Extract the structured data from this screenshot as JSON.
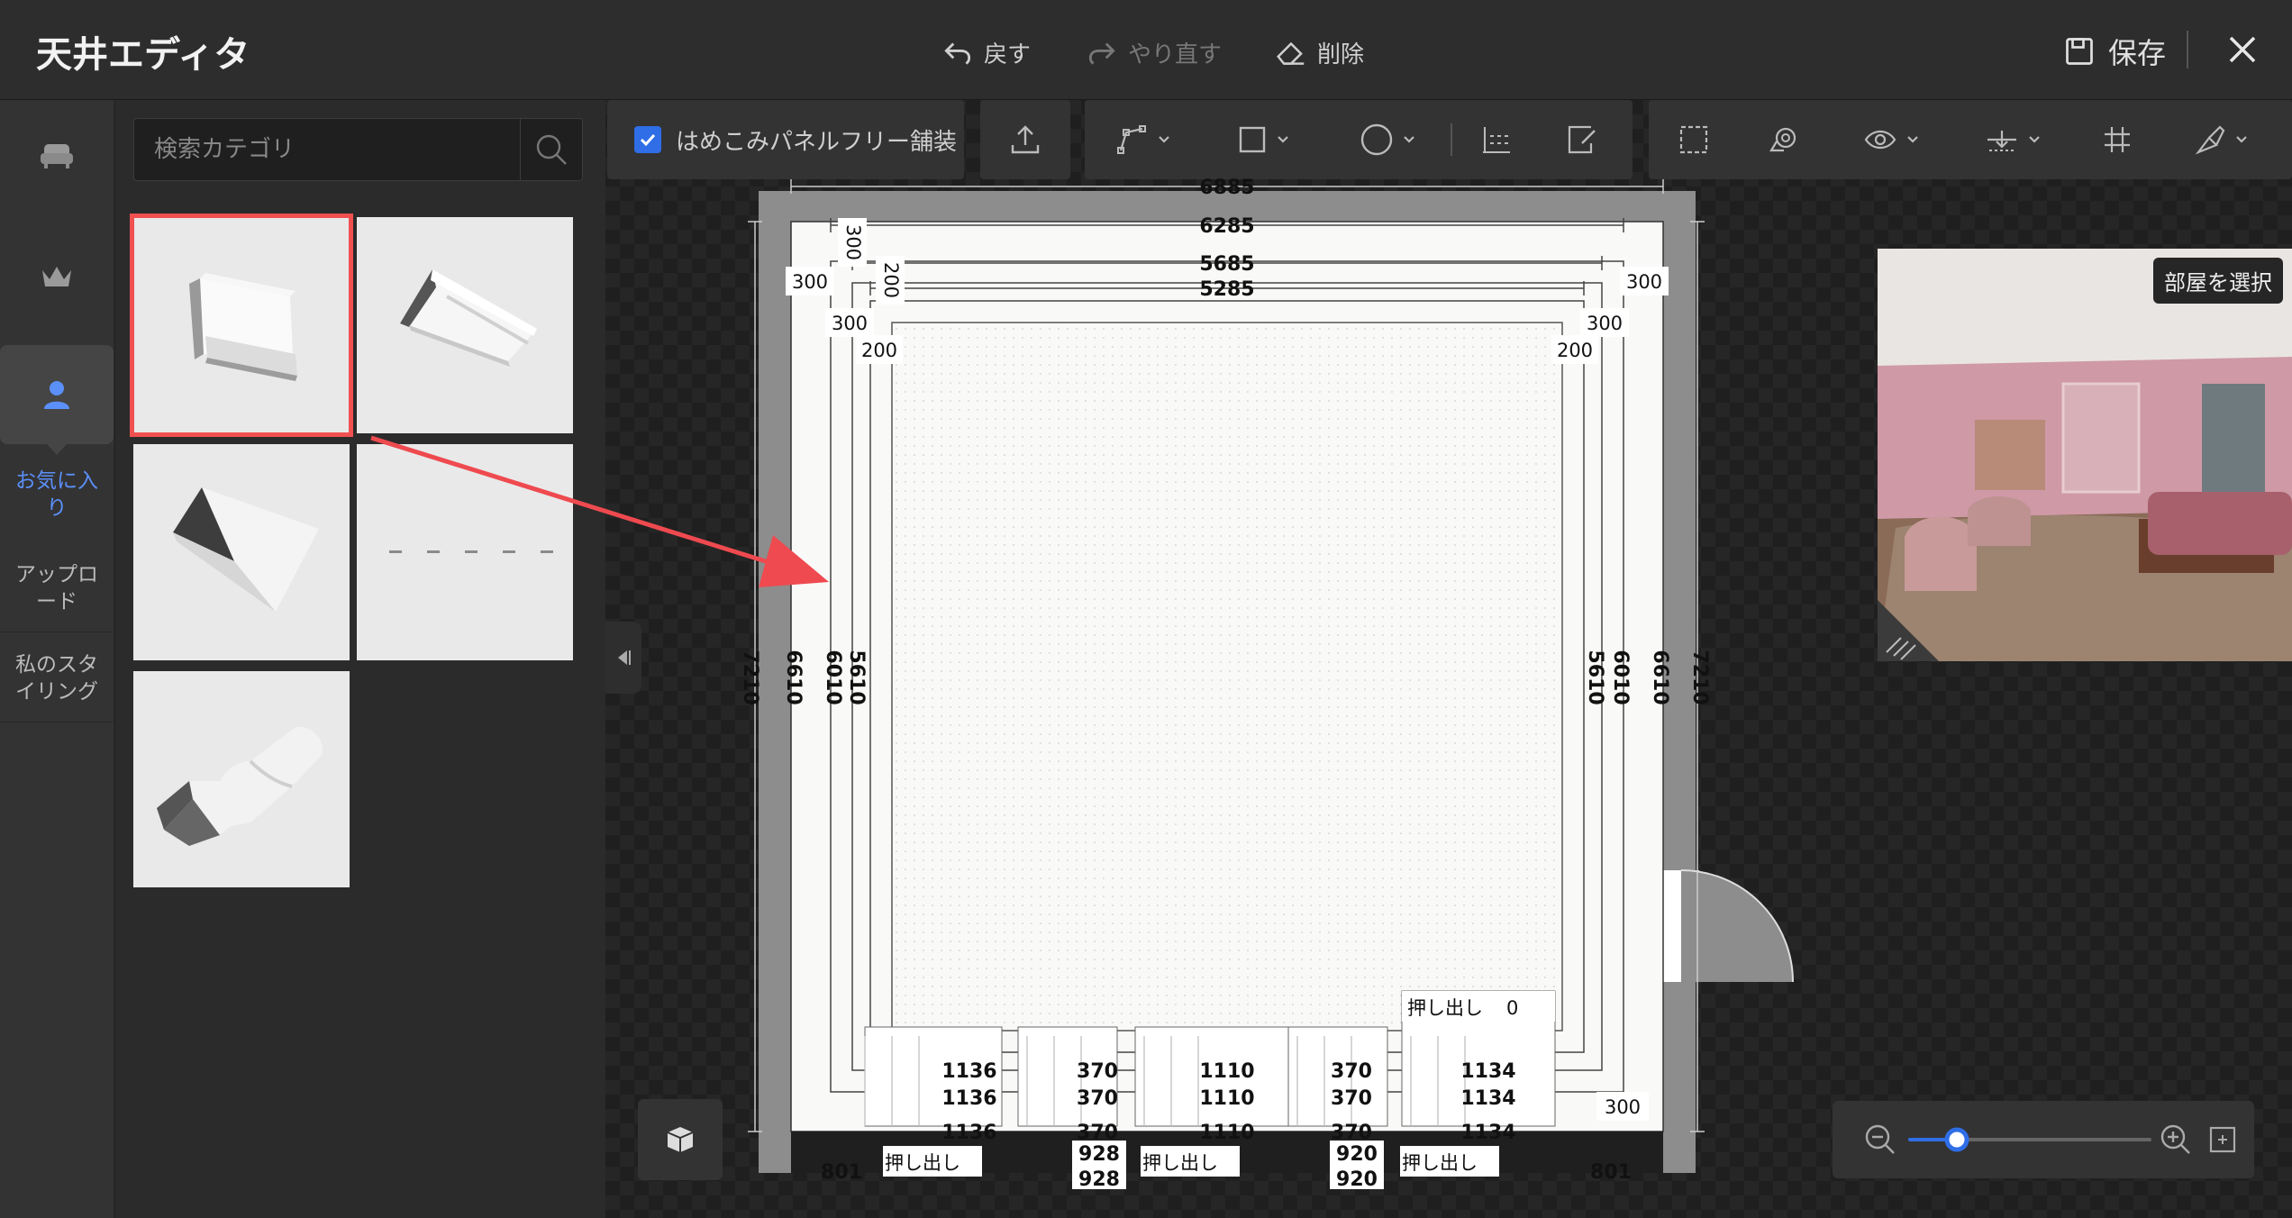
{
  "window": {
    "title": "天井エディタ",
    "undo_label": "戻す",
    "redo_label": "やり直す",
    "delete_label": "削除",
    "save_label": "保存"
  },
  "rail": {
    "items": [
      {
        "icon": "sofa-icon"
      },
      {
        "icon": "crown-icon"
      },
      {
        "icon": "user-icon",
        "label": "お気に入り",
        "active": true
      },
      {
        "label": "アップロード"
      },
      {
        "label": "私のスタイリング"
      }
    ]
  },
  "catalog": {
    "search_placeholder": "検索カテゴリ",
    "tiles": [
      {
        "name": "crown-molding-flat",
        "selected": true
      },
      {
        "name": "crown-molding-cove"
      },
      {
        "name": "crown-molding-triangle"
      },
      {
        "name": "light-strip"
      },
      {
        "name": "crown-molding-ornate"
      }
    ]
  },
  "toolbar": {
    "panel_free_label": "はめこみパネルフリー舗装",
    "panel_free_checked": true
  },
  "preview": {
    "select_room_label": "部屋を選択"
  },
  "plan": {
    "dims_top": [
      "6885",
      "6285",
      "5685",
      "5285"
    ],
    "dims_left": [
      "7210",
      "6610",
      "6010",
      "5610"
    ],
    "dims_right": [
      "5610",
      "6010",
      "6610",
      "7210"
    ],
    "offsets": [
      "300",
      "300",
      "200",
      "300",
      "200",
      "300",
      "300",
      "200"
    ],
    "bottom_labels": [
      "1136",
      "1136",
      "1136",
      "370",
      "370",
      "370",
      "1110",
      "1110",
      "1110",
      "370",
      "370",
      "370",
      "1134",
      "1134",
      "1134",
      "928",
      "928",
      "920",
      "920",
      "801",
      "801",
      "300"
    ],
    "extrude_label": "押し出し",
    "extrude_value": "0"
  },
  "zoom": {
    "level": 0.2
  },
  "colors": {
    "accent": "#2f6ee6",
    "selection": "#f05050",
    "arrow": "#ee4a4f"
  }
}
